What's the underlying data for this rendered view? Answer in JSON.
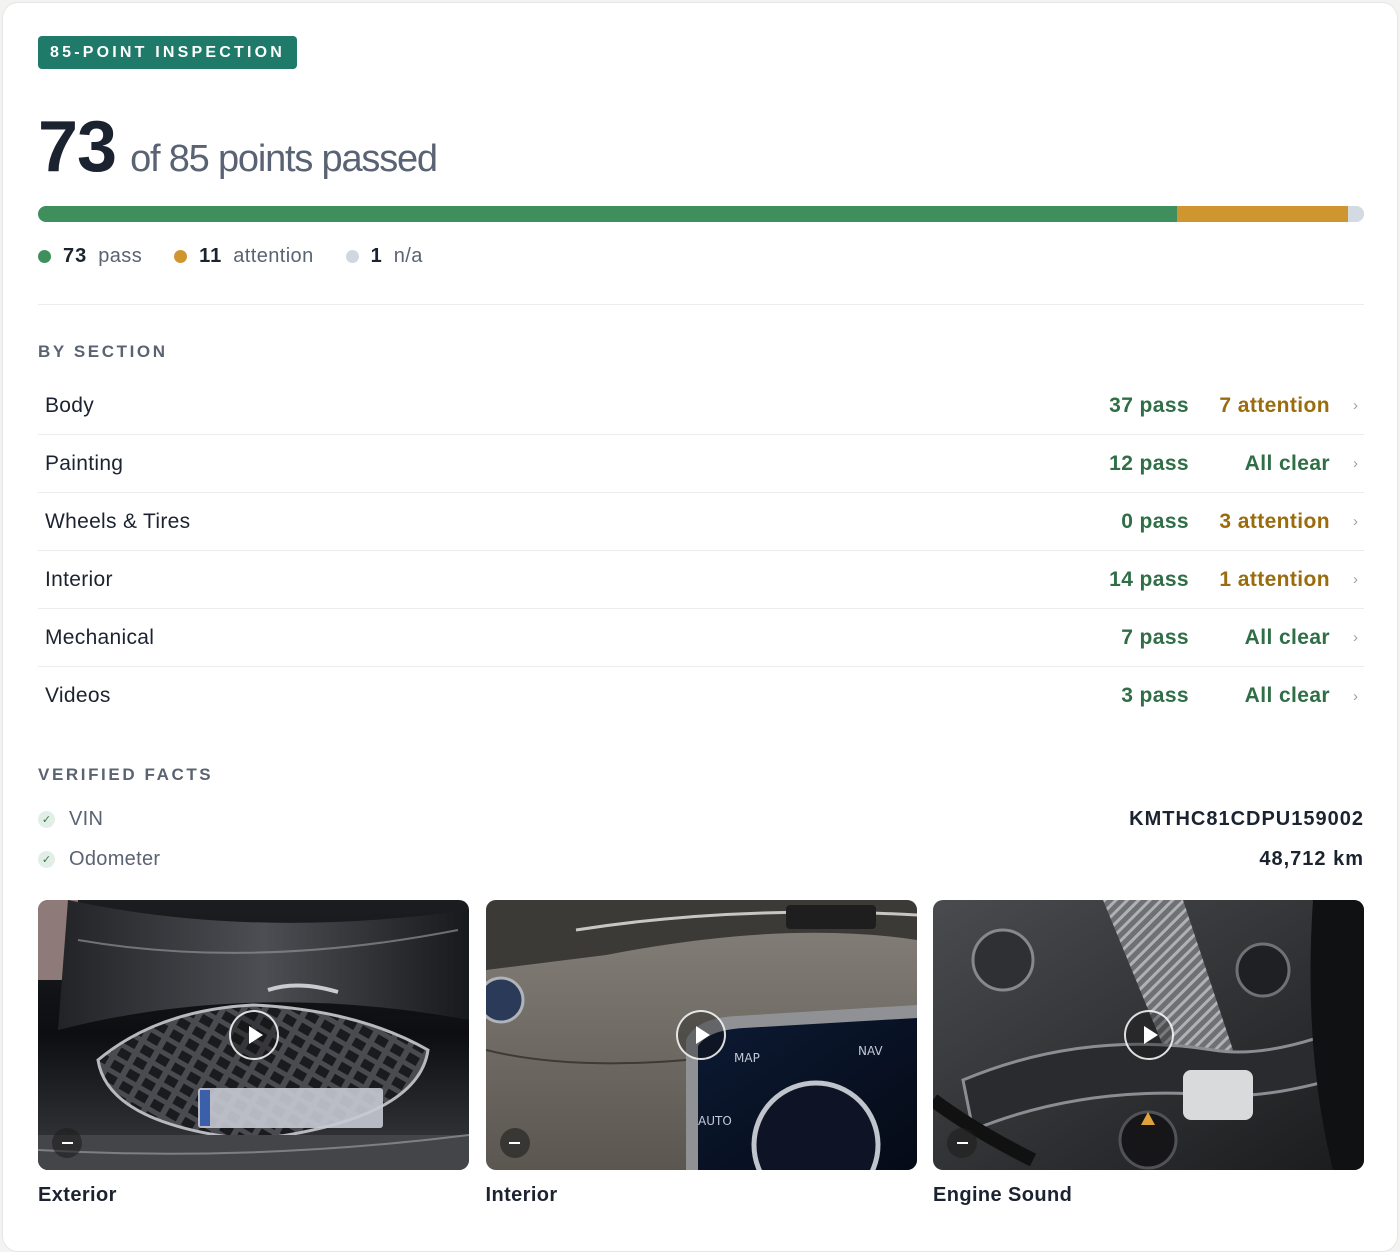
{
  "badge": "85-POINT INSPECTION",
  "score": {
    "passed": "73",
    "summary": "of 85 points passed"
  },
  "progress": {
    "total": 85,
    "segments": [
      {
        "key": "pass",
        "count": 73,
        "color": "#3f8f5c"
      },
      {
        "key": "attention",
        "count": 11,
        "color": "#cf9630"
      },
      {
        "key": "na",
        "count": 1,
        "color": "#d3dae2"
      }
    ]
  },
  "legend": [
    {
      "count": "73",
      "label": "pass",
      "color": "#3f8f5c"
    },
    {
      "count": "11",
      "label": "attention",
      "color": "#cf9630"
    },
    {
      "count": "1",
      "label": "n/a",
      "color": "#cfd8e1"
    }
  ],
  "by_section": {
    "heading": "BY SECTION",
    "rows": [
      {
        "name": "Body",
        "pass": "37 pass",
        "status": "7 attention",
        "status_kind": "attn"
      },
      {
        "name": "Painting",
        "pass": "12 pass",
        "status": "All clear",
        "status_kind": "clear"
      },
      {
        "name": "Wheels & Tires",
        "pass": "0 pass",
        "status": "3 attention",
        "status_kind": "attn"
      },
      {
        "name": "Interior",
        "pass": "14 pass",
        "status": "1 attention",
        "status_kind": "attn"
      },
      {
        "name": "Mechanical",
        "pass": "7 pass",
        "status": "All clear",
        "status_kind": "clear"
      },
      {
        "name": "Videos",
        "pass": "3 pass",
        "status": "All clear",
        "status_kind": "clear"
      }
    ]
  },
  "verified_facts": {
    "heading": "VERIFIED FACTS",
    "items": [
      {
        "label": "VIN",
        "value": "KMTHC81CDPU159002"
      },
      {
        "label": "Odometer",
        "value": "48,712 km"
      }
    ]
  },
  "videos": [
    {
      "label": "Exterior",
      "icon": "play-icon"
    },
    {
      "label": "Interior",
      "icon": "play-icon"
    },
    {
      "label": "Engine Sound",
      "icon": "play-icon"
    }
  ],
  "colors": {
    "accent": "#1f7a6a",
    "pass": "#2f6e46",
    "attention": "#9a6c0e"
  }
}
